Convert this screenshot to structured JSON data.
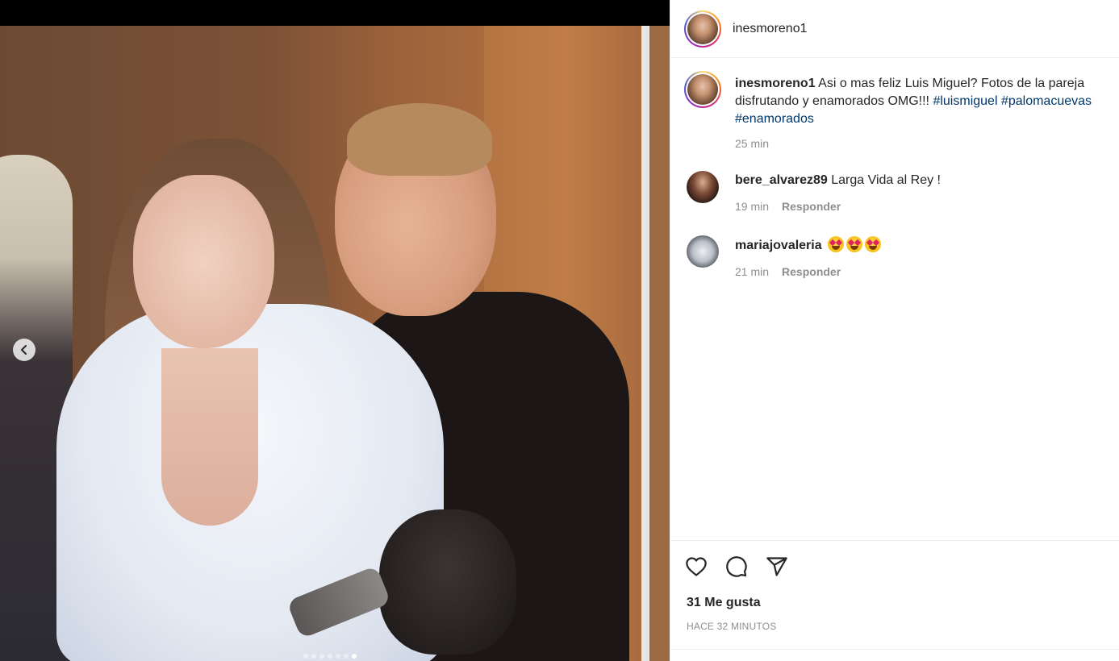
{
  "post": {
    "author": "inesmoreno1",
    "caption": {
      "user": "inesmoreno1",
      "text": " Asi o mas feliz Luis Miguel? Fotos de la pareja disfrutando y enamorados OMG!!! ",
      "hashtags": [
        "#luismiguel",
        "#palomacuevas",
        "#enamorados"
      ],
      "time": "25 min"
    },
    "comments": [
      {
        "user": "bere_alvarez89",
        "text": " Larga Vida al Rey !",
        "time": "19 min",
        "reply_label": "Responder"
      },
      {
        "user": "mariajovaleria",
        "text": " ",
        "emojis": [
          "heart-eyes-emoji",
          "heart-eyes-emoji",
          "heart-eyes-emoji"
        ],
        "time": "21 min",
        "reply_label": "Responder"
      }
    ],
    "likes": "31 Me gusta",
    "timestamp": "HACE 32 MINUTOS"
  },
  "media": {
    "carousel_total": 7,
    "carousel_active_index": 6,
    "prev_icon": "chevron-left-icon"
  },
  "icons": {
    "like": "heart-icon",
    "comment": "comment-bubble-icon",
    "share": "paper-plane-icon"
  },
  "colors": {
    "hashtag": "#00376b",
    "text": "#262626",
    "muted": "#8e8e8e",
    "border": "#efefef"
  }
}
